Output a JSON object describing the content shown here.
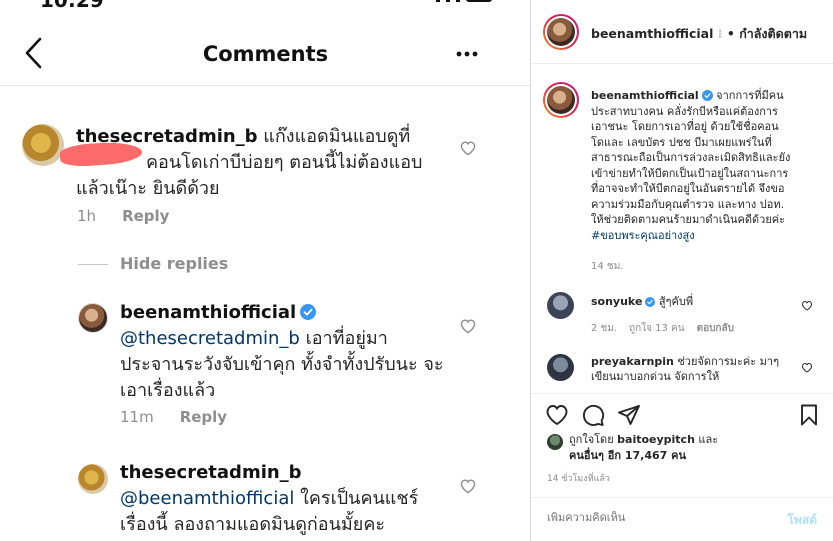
{
  "screenshot": {
    "status": {
      "time": "10:29"
    },
    "header": {
      "title": "Comments"
    },
    "comments": [
      {
        "username": "thesecretadmin_b",
        "text_line1": " แก๊งแอดมินแอบดูที่",
        "text_line2": "คอนโดเก่าบีบ่อยๆ ตอนนี้ไม่ต้องแอบ",
        "text_line3": "แล้วเน๊าะ ยินดีด้วย",
        "time": "1h",
        "reply": "Reply"
      },
      {
        "username": "beenamthiofficial",
        "mention": "@thesecretadmin_b",
        "text_line1": " เอาที่อยู่มา",
        "text_line2": "ประจานระวังจับเข้าคุก ทั้งจำทั้งปรับนะ จะ",
        "text_line3": "เอาเรื่องแล้ว",
        "time": "11m",
        "reply": "Reply"
      },
      {
        "username": "thesecretadmin_b",
        "mention": "@beenamthiofficial",
        "text_line1": " ใครเป็นคนแชร์",
        "text_line2": "เรื่องนี้ ลองถามแอดมินดูก่อนมั้ยคะ"
      }
    ],
    "hide_replies": "Hide replies"
  },
  "panel": {
    "header": {
      "username": "beenamthiofficial",
      "separator": " • ",
      "follow": "กำลังติดตาม"
    },
    "caption": {
      "username": "beenamthiofficial",
      "lines": [
        " จากการที่มีคน",
        "ประสาทบางคน คลั่งรักบีหรือแค่ต้องการ",
        "เอาชนะ โดยการเอาที่อยู่ ด้วยใช้ชื่อคอน",
        "โดและ เลขบัตร ปชช บีมาเผยแพร่ในที่",
        "สาธารณะถือเป็นการล่วงละเมิดสิทธิและยัง",
        "เข้าข่ายทำให้บีตกเป็นเป้าอยู่ในสถานะการ",
        "ที่อาจจะทำให้บีตกอยู่ในอันตรายได้ จึงขอ",
        "ความร่วมมือกับคุณตำรวจ และทาง ปอท.",
        "ให้ช่วยติดตามคนร้ายมาดำเนินคดีด้วยค่ะ"
      ],
      "hashtag": "#ขอบพระคุณอย่างสูง",
      "age": "14 ชม."
    },
    "comments": [
      {
        "username": "sonyuke",
        "text": " สู้ๆคับพี่",
        "age": "2 ชม.",
        "likes": "ถูกใจ 13 คน",
        "reply": "ตอบกลับ"
      },
      {
        "username": "preyakarnpin",
        "text_line1": " ช่วยจัดการมะค่ะ มาๆ",
        "text_line2": "เขียนมาบอกด่วน จัดการให้"
      }
    ],
    "likes": {
      "prefix": "ถูกใจโดย ",
      "user": "baitoeypitch",
      "mid": " และ",
      "others": "คนอื่นๆ อีก 17,467 คน"
    },
    "time": "14 ชั่วโมงที่แล้ว",
    "add_comment": {
      "placeholder": "เพิ่มความคิดเห็น",
      "post": "โพสต์"
    },
    "colors": {
      "verified": "#3897f0",
      "mention": "#00376b",
      "muted": "#8e8e8e",
      "post_disabled": "#b2dffc"
    }
  }
}
